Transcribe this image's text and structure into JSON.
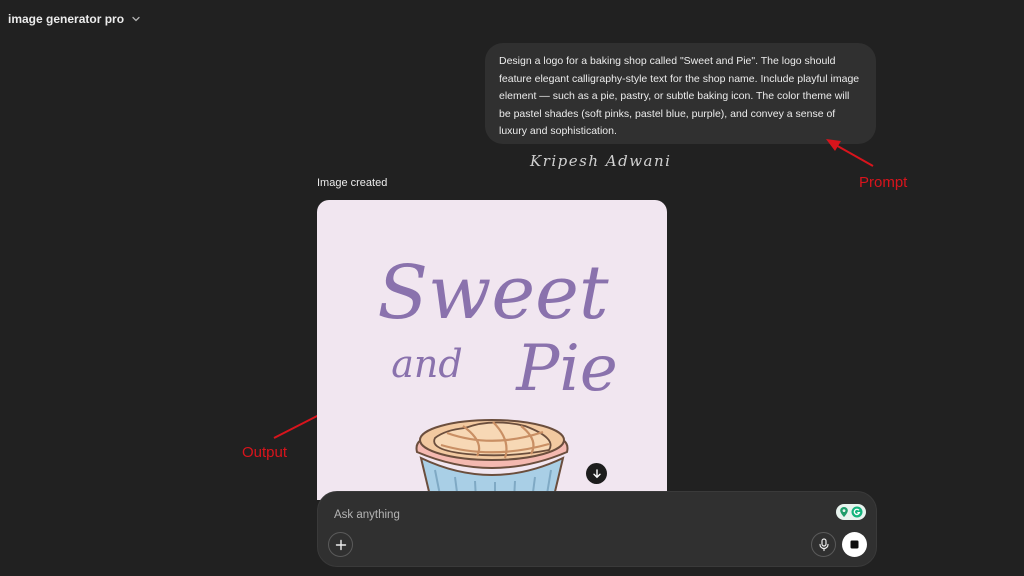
{
  "header": {
    "app_title": "image generator pro"
  },
  "prompt": {
    "text": "Design a logo for a baking shop called \"Sweet and Pie\". The logo should feature elegant calligraphy-style text for the shop name. Include playful image element — such as a pie, pastry, or subtle baking icon. The color theme will be pastel shades (soft pinks, pastel blue, purple), and convey a sense of luxury and sophistication."
  },
  "signature": "Kripesh Adwani",
  "annotations": {
    "prompt_label": "Prompt",
    "output_label": "Output",
    "color": "#d8141c"
  },
  "response": {
    "status": "Image created",
    "image": {
      "line1": "Sweet",
      "line2a": "and",
      "line2b": "Pie",
      "background": "#f1e6f0",
      "text_color": "#8a72ad"
    }
  },
  "composer": {
    "placeholder": "Ask anything"
  },
  "icons": {
    "header_chevron": "chevron-down-icon",
    "download": "download-icon",
    "plus": "plus-icon",
    "mic": "microphone-icon",
    "stop": "stop-icon",
    "extension": "grammarly-extension-icon"
  }
}
